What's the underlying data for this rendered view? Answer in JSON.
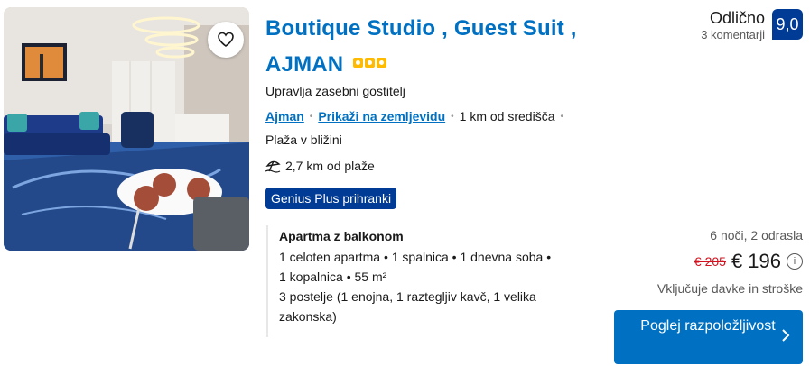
{
  "property": {
    "title": "Boutique Studio , Guest Suit , AJMAN",
    "stars": 3,
    "managed_by": "Upravlja zasebni gostitelj",
    "location_link": "Ajman",
    "map_link": "Prikaži na zemljevidu",
    "center_distance": "1 km od središča",
    "beach_note": "Plaža v bližini",
    "beach_distance": "2,7 km od plaže",
    "genius_badge": "Genius Plus prihranki"
  },
  "room": {
    "name": "Apartma z balkonom",
    "line1": "1 celoten apartma • 1 spalnica • 1 dnevna soba •",
    "line2": "1 kopalnica • 55 m²",
    "line3": "3 postelje (1 enojna, 1 raztegljiv kavč, 1 velika",
    "line4": "zakonska)"
  },
  "review": {
    "label": "Odlično",
    "count": "3 komentarji",
    "score": "9,0"
  },
  "price": {
    "stay": "6 noči, 2 odrasla",
    "old": "€ 205",
    "new": "€ 196",
    "info_glyph": "i",
    "taxes": "Vključuje davke in stroške"
  },
  "cta": {
    "label": "Poglej razpoložljivost"
  },
  "icons": {
    "favorite": "heart-icon",
    "beach": "beach-umbrella-icon",
    "chevron": "chevron-right-icon"
  },
  "colors": {
    "brand_blue": "#0071c2",
    "dark_blue": "#003b95",
    "star_yellow": "#febb02",
    "discount_red": "#d4111e"
  }
}
